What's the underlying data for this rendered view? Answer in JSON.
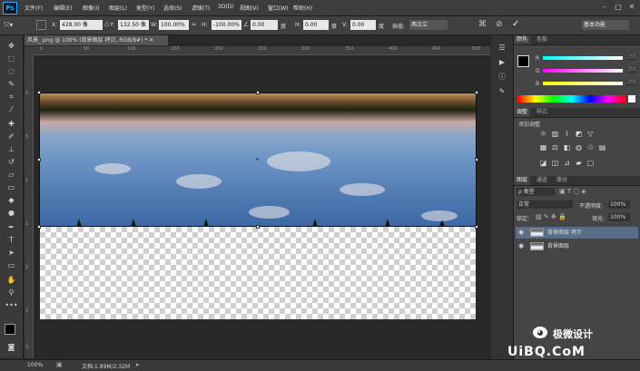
{
  "app": {
    "logo": "Ps"
  },
  "menu": [
    "文件(F)",
    "编辑(E)",
    "图像(I)",
    "图层(L)",
    "类型(Y)",
    "选择(S)",
    "滤镜(T)",
    "3D(D)",
    "视图(V)",
    "窗口(W)",
    "帮助(H)"
  ],
  "window_controls": {
    "minimize": "–",
    "maximize": "□",
    "close": "✕"
  },
  "options": {
    "x_label": "X:",
    "x_value": "428.00 像",
    "y_label": "Y:",
    "y_value": "132.50 像",
    "w_label": "W:",
    "w_value": "100.00%",
    "h_label": "H:",
    "h_value": "-100.00%",
    "angle_value": "0.00",
    "angle_unit": "度",
    "hskew_label": "H:",
    "hskew_value": "0.00",
    "hskew_unit": "度",
    "vskew_label": "V:",
    "vskew_value": "0.00",
    "vskew_unit": "度",
    "interp_label": "插值:",
    "interp_value": "两次立",
    "workspace": "基本功能"
  },
  "document": {
    "tab": "风景_.png @ 100% (背景图层 拷贝, RGB/8#) * ✕",
    "zoom": "100%",
    "doc_size": "文档:1.89M/2.32M"
  },
  "ruler_ticks": [
    "0",
    "50",
    "100",
    "150",
    "200",
    "250",
    "300",
    "350",
    "400",
    "450",
    "500"
  ],
  "ruler_ticks_v": [
    "0",
    "5",
    "1",
    "1",
    "2",
    "2",
    "3"
  ],
  "color_panel": {
    "tabs": [
      "颜色",
      "色板"
    ],
    "sliders": [
      {
        "label": "R",
        "value": "255"
      },
      {
        "label": "G",
        "value": "255"
      },
      {
        "label": "B",
        "value": "255"
      }
    ]
  },
  "adjust_panel": {
    "tabs": [
      "调整",
      "样式"
    ],
    "title": "添加调整"
  },
  "layers_panel": {
    "tabs": [
      "图层",
      "通道",
      "路径"
    ],
    "kind_label": "ρ 类型",
    "blend_mode": "正常",
    "opacity_label": "不透明度:",
    "opacity_value": "100%",
    "lock_label": "锁定:",
    "fill_label": "填充:",
    "fill_value": "100%",
    "layers": [
      {
        "name": "背景图层 拷贝",
        "selected": true
      },
      {
        "name": "背景图层",
        "selected": false
      }
    ]
  },
  "watermark": {
    "brand": "极微设计",
    "site": "UiBQ.CoM"
  },
  "colors": {
    "accent": "#31a8ff",
    "selected_layer": "#5a6c86"
  }
}
